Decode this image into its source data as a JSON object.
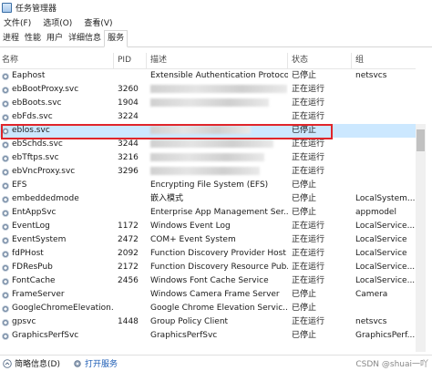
{
  "window": {
    "title": "任务管理器"
  },
  "menu": [
    "文件(F)",
    "选项(O)",
    "查看(V)"
  ],
  "tabs": [
    {
      "label": "进程",
      "active": false
    },
    {
      "label": "性能",
      "active": false
    },
    {
      "label": "用户",
      "active": false
    },
    {
      "label": "详细信息",
      "active": false
    },
    {
      "label": "服务",
      "active": true
    }
  ],
  "columns": {
    "name": "名称",
    "pid": "PID",
    "desc": "描述",
    "status": "状态",
    "group": "组"
  },
  "rows": [
    {
      "name": "Eaphost",
      "pid": "",
      "desc": "Extensible Authentication Protocol",
      "status": "已停止",
      "group": "netsvcs"
    },
    {
      "name": "ebBootProxy.svc",
      "pid": "3260",
      "desc": "",
      "status": "正在运行",
      "group": ""
    },
    {
      "name": "ebBoots.svc",
      "pid": "1904",
      "desc": "",
      "status": "正在运行",
      "group": ""
    },
    {
      "name": "ebFds.svc",
      "pid": "3224",
      "desc": "",
      "status": "正在运行",
      "group": ""
    },
    {
      "name": "eblos.svc",
      "pid": "",
      "desc": "",
      "status": "已停止",
      "group": "",
      "selected": true
    },
    {
      "name": "ebSchds.svc",
      "pid": "3244",
      "desc": "",
      "status": "正在运行",
      "group": ""
    },
    {
      "name": "ebTftps.svc",
      "pid": "3216",
      "desc": "",
      "status": "正在运行",
      "group": ""
    },
    {
      "name": "ebVncProxy.svc",
      "pid": "3296",
      "desc": "",
      "status": "正在运行",
      "group": ""
    },
    {
      "name": "EFS",
      "pid": "",
      "desc": "Encrypting File System (EFS)",
      "status": "已停止",
      "group": ""
    },
    {
      "name": "embeddedmode",
      "pid": "",
      "desc": "嵌入模式",
      "status": "已停止",
      "group": "LocalSystem..."
    },
    {
      "name": "EntAppSvc",
      "pid": "",
      "desc": "Enterprise App Management Ser...",
      "status": "已停止",
      "group": "appmodel"
    },
    {
      "name": "EventLog",
      "pid": "1172",
      "desc": "Windows Event Log",
      "status": "正在运行",
      "group": "LocalService..."
    },
    {
      "name": "EventSystem",
      "pid": "2472",
      "desc": "COM+ Event System",
      "status": "正在运行",
      "group": "LocalService"
    },
    {
      "name": "fdPHost",
      "pid": "2092",
      "desc": "Function Discovery Provider Host",
      "status": "正在运行",
      "group": "LocalService"
    },
    {
      "name": "FDResPub",
      "pid": "2172",
      "desc": "Function Discovery Resource Pub...",
      "status": "正在运行",
      "group": "LocalService..."
    },
    {
      "name": "FontCache",
      "pid": "2456",
      "desc": "Windows Font Cache Service",
      "status": "正在运行",
      "group": "LocalService..."
    },
    {
      "name": "FrameServer",
      "pid": "",
      "desc": "Windows Camera Frame Server",
      "status": "已停止",
      "group": "Camera"
    },
    {
      "name": "GoogleChromeElevation...",
      "pid": "",
      "desc": "Google Chrome Elevation Servic...",
      "status": "已停止",
      "group": ""
    },
    {
      "name": "gpsvc",
      "pid": "1448",
      "desc": "Group Policy Client",
      "status": "正在运行",
      "group": "netsvcs"
    },
    {
      "name": "GraphicsPerfSvc",
      "pid": "",
      "desc": "GraphicsPerfSvc",
      "status": "已停止",
      "group": "GraphicsPerf..."
    }
  ],
  "statusbar": {
    "brief": "简略信息(D)",
    "open_services": "打开服务"
  },
  "watermark": "CSDN @shuai一吖",
  "colors": {
    "selection": "#cce8ff",
    "highlight_border": "#e0262b",
    "link": "#1c5cb5"
  }
}
